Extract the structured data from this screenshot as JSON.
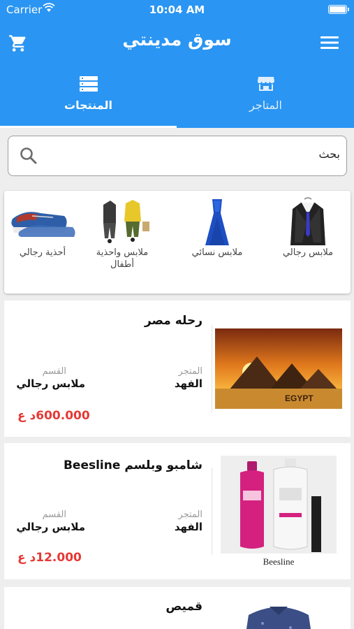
{
  "status": {
    "carrier": "Carrier",
    "time": "10:04 AM"
  },
  "header": {
    "title": "سوق مدينتي"
  },
  "tabs": [
    {
      "label": "المنتجات",
      "icon": "list-icon",
      "active": true
    },
    {
      "label": "المتاجر",
      "icon": "store-icon",
      "active": false
    }
  ],
  "search": {
    "placeholder": "بحث"
  },
  "categories": [
    {
      "label": "ملابس رجالي",
      "icon": "suit-icon"
    },
    {
      "label": "ملابس نسائي",
      "icon": "dress-icon"
    },
    {
      "label": "ملابس واحذية أطفال",
      "icon": "kids-clothes-icon"
    },
    {
      "label": "أحذية رجالي",
      "icon": "shoes-icon"
    }
  ],
  "products": [
    {
      "title": "رحله مصر",
      "store_label": "المتجر",
      "store": "الفهد",
      "category_label": "القسم",
      "category": "ملابس رجالي",
      "price": "600.000د ع",
      "image": "egypt-pyramids-image",
      "image_text": "EGYPT"
    },
    {
      "title": "شامبو وبلسم Beesline",
      "store_label": "المتجر",
      "store": "الفهد",
      "category_label": "القسم",
      "category": "ملابس رجالي",
      "price": "12.000د ع",
      "image": "beesline-shampoo-image",
      "image_text": "Beesline"
    },
    {
      "title": "قميص",
      "image": "shirt-image"
    }
  ],
  "colors": {
    "primary": "#2a95f2",
    "price": "#e53935"
  }
}
